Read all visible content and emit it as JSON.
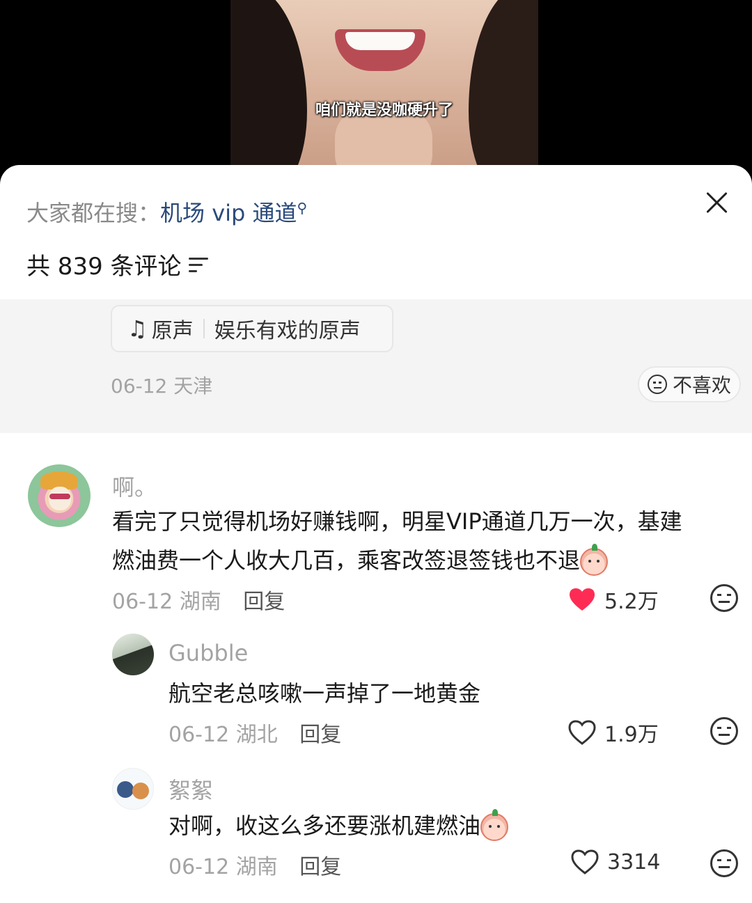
{
  "video": {
    "subtitle": "咱们就是没咖硬升了"
  },
  "sheet": {
    "search_prefix": "大家都在搜：",
    "search_keyword": "机场 vip 通道",
    "comment_count": "共 839 条评论"
  },
  "previous_comment": {
    "sound_label": "原声",
    "sound_source": "娱乐有戏的原声",
    "date": "06-12",
    "location": "天津",
    "dislike_label": "不喜欢"
  },
  "comments": [
    {
      "name": "啊。",
      "text_line1": "看完了只觉得机场好赚钱啊，明星VIP通道几万一次，基建",
      "text_line2": "燃油费一个人收大几百，乘客改签退签钱也不退",
      "date": "06-12",
      "location": "湖南",
      "reply_label": "回复",
      "likes": "5.2万",
      "liked": true
    },
    {
      "name": "Gubble",
      "text": "航空老总咳嗽一声掉了一地黄金",
      "date": "06-12",
      "location": "湖北",
      "reply_label": "回复",
      "likes": "1.9万",
      "liked": false
    },
    {
      "name": "絮絮",
      "text": "对啊，收这么多还要涨机建燃油",
      "date": "06-12",
      "location": "湖南",
      "reply_label": "回复",
      "likes": "3314",
      "liked": false
    }
  ],
  "colors": {
    "heart_liked": "#fe2c55",
    "keyword": "#2a4a7b",
    "muted": "#a3a3a3"
  },
  "icons": [
    "close-icon",
    "filter-icon",
    "music-note-icon",
    "dislike-face-icon",
    "heart-icon",
    "smiley-emoji-icon"
  ]
}
